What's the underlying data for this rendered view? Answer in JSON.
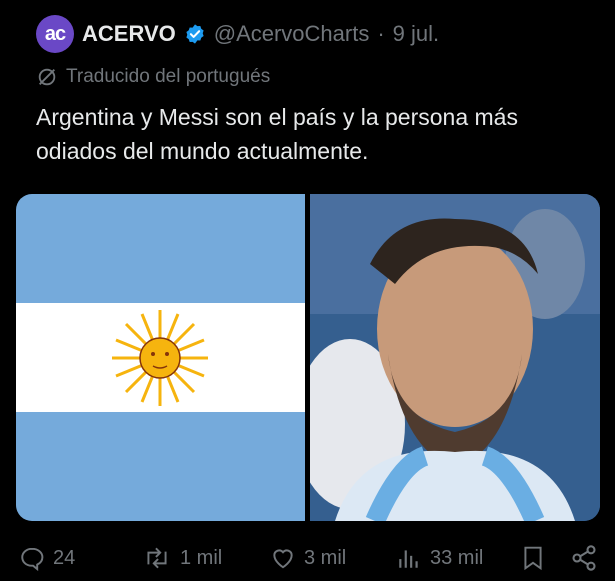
{
  "account": {
    "avatar_text": "ac",
    "name": "ACERVO",
    "handle": "@AcervoCharts",
    "separator": "·",
    "date": "9 jul."
  },
  "translation_note": "Traducido del portugués",
  "post_text": "Argentina y Messi son el país y la persona más odiados del mundo actualmente.",
  "actions": {
    "replies": "24",
    "reposts": "1 mil",
    "likes": "3 mil",
    "views": "33 mil"
  },
  "colors": {
    "background": "#000000",
    "text_primary": "#e7e9ea",
    "text_secondary": "#71767b",
    "verified": "#1d9bf0",
    "avatar": "#6a48c6",
    "flag_blue": "#75aadb",
    "sun": "#f6b40e"
  },
  "icons": [
    "verified-badge-icon",
    "translate-icon",
    "reply-icon",
    "repost-icon",
    "like-icon",
    "views-icon",
    "bookmark-icon",
    "share-icon"
  ]
}
